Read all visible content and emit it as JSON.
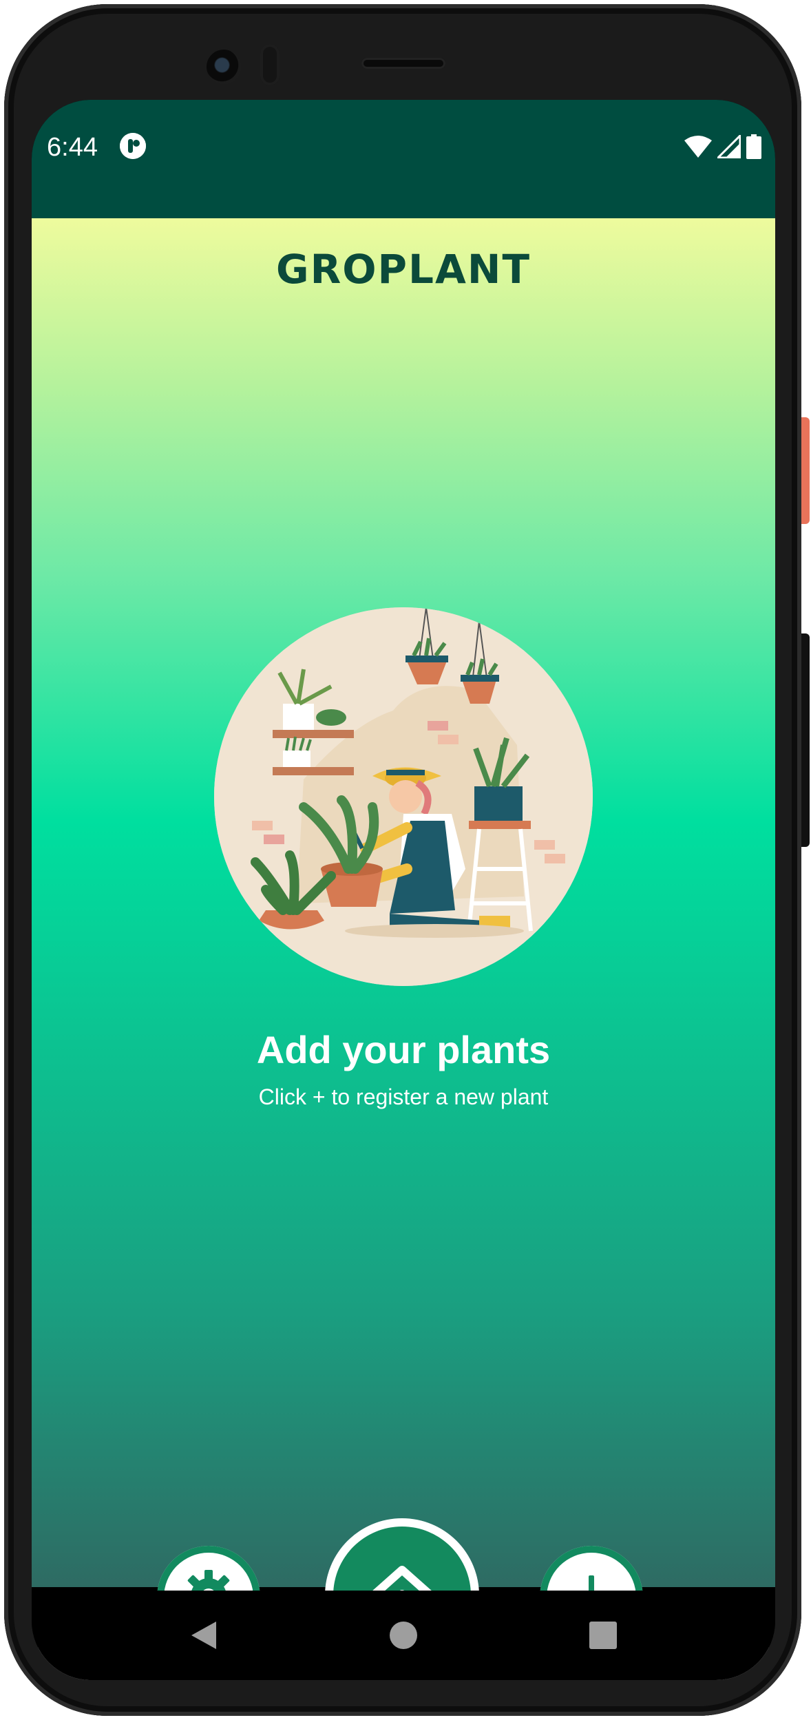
{
  "status_bar": {
    "time": "6:44",
    "app_icon": "app-notification-icon",
    "icons": [
      "wifi-icon",
      "cellular-signal-icon",
      "battery-icon"
    ]
  },
  "header": {
    "title": "GROPLANT"
  },
  "empty_state": {
    "illustration": "gardener-with-potted-plants-illustration",
    "title": "Add your plants",
    "subtitle": "Click + to register a new plant"
  },
  "bottom_nav": {
    "settings_icon": "gear-icon",
    "main_icon": "double-chevron-up-icon",
    "add_icon": "plus-icon"
  },
  "system_nav": {
    "back_icon": "back-triangle-icon",
    "home_icon": "home-circle-icon",
    "recents_icon": "recents-square-icon"
  },
  "colors": {
    "status_bar": "#004d40",
    "brand_dark": "#0b4a3a",
    "accent": "#138a5e",
    "gradient_top": "#eefb9d",
    "gradient_mid": "#00df9f",
    "gradient_bottom": "#2e6b63"
  }
}
